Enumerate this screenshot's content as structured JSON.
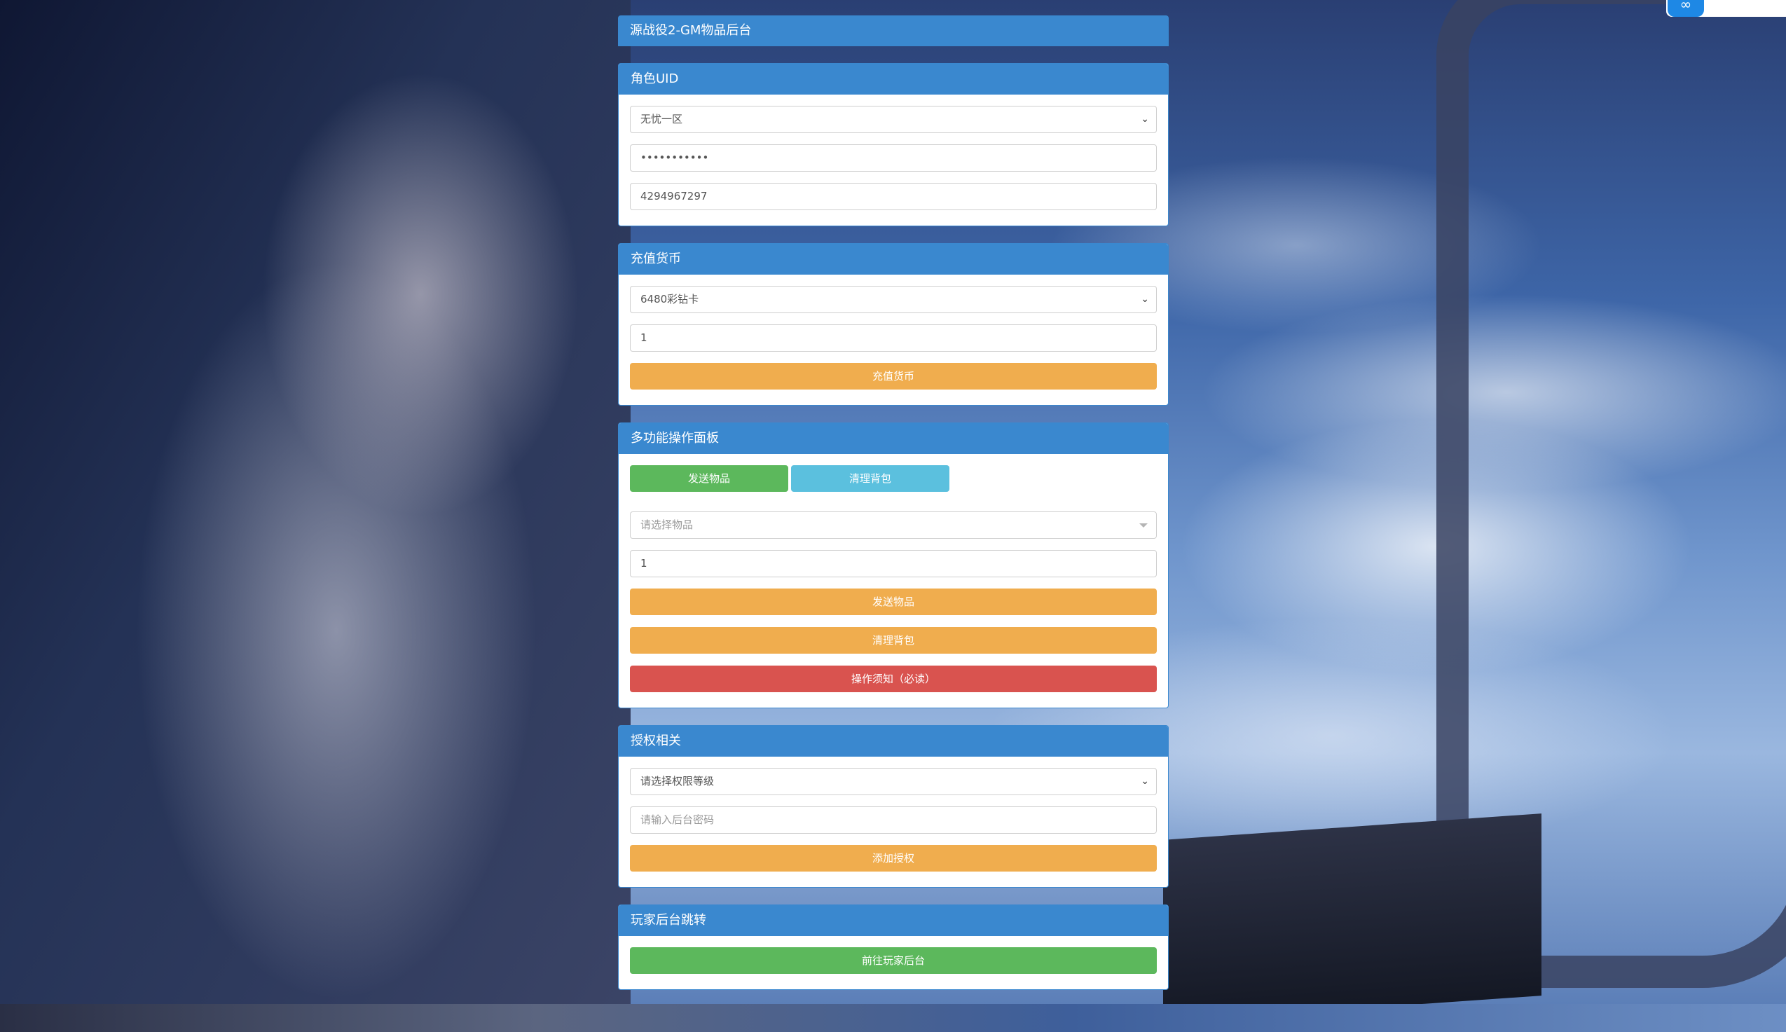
{
  "colors": {
    "primary": "#3a88cf",
    "warning": "#f0ad4e",
    "danger": "#d9534f",
    "success": "#5cb85c",
    "info": "#5bc0de"
  },
  "page_title": "源战役2-GM物品后台",
  "role_panel": {
    "heading": "角色UID",
    "server_select": "无忧一区",
    "password_value": "•••••••••••",
    "uid_value": "4294967297"
  },
  "recharge_panel": {
    "heading": "充值货币",
    "currency_select": "6480彩钻卡",
    "amount_value": "1",
    "submit_label": "充值货币"
  },
  "multi_panel": {
    "heading": "多功能操作面板",
    "tab_send_label": "发送物品",
    "tab_clear_label": "清理背包",
    "item_select_placeholder": "请选择物品",
    "quantity_value": "1",
    "send_label": "发送物品",
    "clear_label": "清理背包",
    "notice_label": "操作须知（必读）"
  },
  "auth_panel": {
    "heading": "授权相关",
    "level_select": "请选择权限等级",
    "password_placeholder": "请输入后台密码",
    "submit_label": "添加授权"
  },
  "player_panel": {
    "heading": "玩家后台跳转",
    "go_label": "前往玩家后台"
  }
}
